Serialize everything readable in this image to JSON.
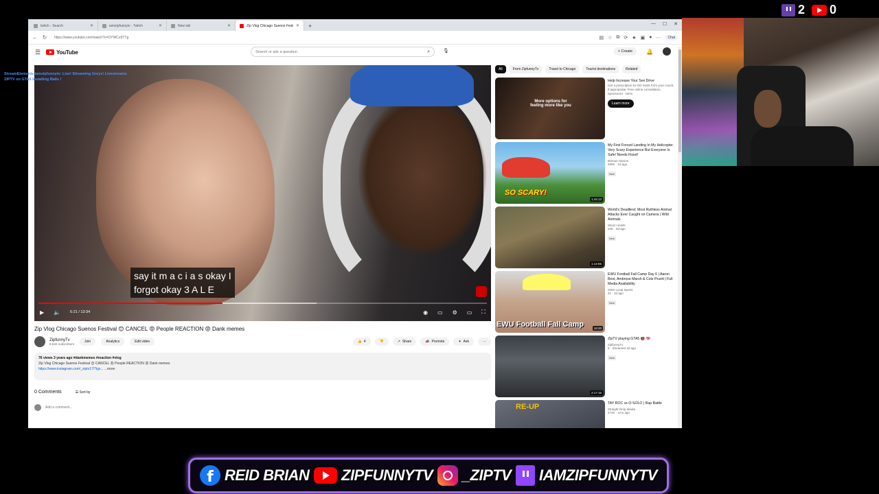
{
  "counts": {
    "twitch": "2",
    "youtube": "0"
  },
  "chat_overlay": {
    "source": "StreamElements",
    "message": "iamzipfunnytv: Live! Streaming Greys! Livestreams ZIPTV on GTA5 Installing Balls !"
  },
  "browser": {
    "tabs": [
      {
        "label": "twitch - Search",
        "active": false
      },
      {
        "label": "iamzipfunnytv - Twitch",
        "active": false
      },
      {
        "label": "New tab",
        "active": false
      },
      {
        "label": "Zip Vlog Chicago Suenos Festival ...",
        "active": true
      }
    ],
    "url": "https://www.youtube.com/watch?v=OYWCu5TTg",
    "chat_label": "Chat"
  },
  "youtube": {
    "logo": "YouTube",
    "search_placeholder": "Search or ask a question",
    "create_label": "Create",
    "player": {
      "subtitle": "say it m a c i a s okay I\nforgot okay 3 A L E",
      "time": "6:21 / 13:34",
      "progress_played": 0.41,
      "progress_loaded": 0.62
    },
    "title": "Zip Vlog Chicago Suenos Festival 😊 CANCEL 😡 People REACTION 😡 Dank memes",
    "channel": {
      "name": "ZipfunnyTv",
      "subs": "8.64K subscribers"
    },
    "owner_buttons": [
      "Join",
      "Analytics",
      "Edit video"
    ],
    "actions": {
      "likes": "4",
      "share": "Share",
      "promote": "Promote",
      "ask": "Ask"
    },
    "description": {
      "meta": "76 views  3 years ago  #dankmemes #reaction #vlog",
      "text": "Zip Vlog Chicago Suenos Festival 😊 CANCEL 😡 People REACTION 😡 Dank memes",
      "link": "https://www.instagram.com/_ziptv17/?igs...",
      "more": "...more"
    },
    "comments": {
      "count": "0 Comments",
      "sort": "Sort by",
      "add": "Add a comment..."
    },
    "chips": [
      "All",
      "From ZipfunnyTv",
      "Travel to Chicago",
      "Tourist destinations",
      "Related"
    ],
    "ad": {
      "title": "Help Increase Your Sex Drive",
      "desc": "Get a prescription for ED meds from your couch, if appropriate. Free online consultation.",
      "sponsored": "Sponsored · Hims",
      "cta": "Learn more",
      "thumb_text": "More options for feeling more like you"
    },
    "recommendations": [
      {
        "title": "My First Forced Landing In My Helicopter. Very Scary Experience But Everyone Is Safe! Needs Fixed!",
        "channel": "Brenan Alexion",
        "stats": "490K · 1d ago",
        "badge": "New",
        "duration": "1:44:13",
        "thumb_text": "SO SCARY!"
      },
      {
        "title": "World's Deadliest: Most Ruthless Animal Attacks Ever Caught on Camera | Wild Animals",
        "channel": "WILD HAWK",
        "stats": "34K · 5d ago",
        "badge": "New",
        "duration": "1:14:55",
        "thumb_text": ""
      },
      {
        "title": "EWU Football Fall Camp Day 6 | Aaron Best, Ambrose Marsh & Cole Pruett | Full Media Availability",
        "channel": "SWX Local Sports",
        "stats": "21 · 1d ago",
        "badge": "New",
        "duration": "18:20",
        "thumb_text": "EWU Football Fall Camp"
      },
      {
        "title": "ZipTV playing GTA5 🔞 💖",
        "channel": "ZipfunnyTv",
        "stats": "5 · Streamed 4d ago",
        "badge": "New",
        "duration": "2:17:15",
        "thumb_text": ""
      },
      {
        "title": "TAY ROC vs O-SOLO | Rap Battle",
        "channel": "Straight Drop Media",
        "stats": "474K · 1mo ago",
        "badge": "",
        "duration": "",
        "thumb_text": "RE-UP"
      }
    ]
  },
  "banner": {
    "facebook": "REID BRIAN",
    "youtube": "ZIPFUNNYTV",
    "instagram": "_ZIPTV",
    "twitch": "IAMZIPFUNNYTV"
  },
  "colors": {
    "accent": "#ff0000",
    "twitch": "#9146ff",
    "banner_border": "#a070e0"
  }
}
